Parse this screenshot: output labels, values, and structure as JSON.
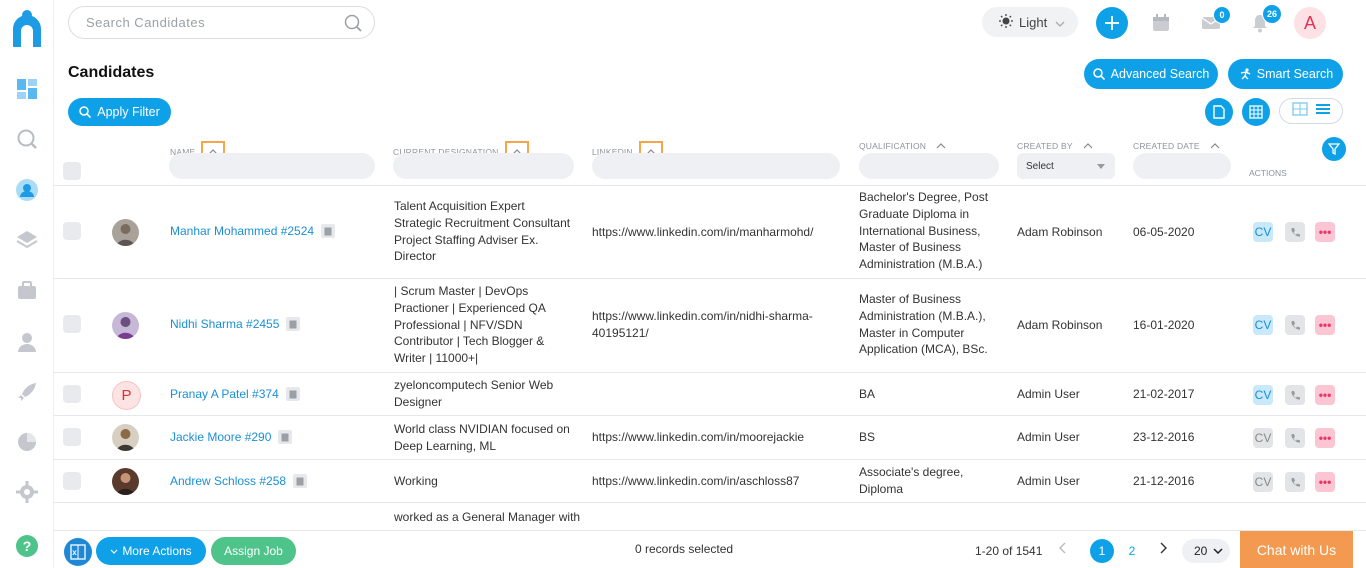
{
  "search": {
    "placeholder": "Search Candidates"
  },
  "theme": {
    "label": "Light"
  },
  "notifications": {
    "mail_count": "0",
    "bell_count": "26"
  },
  "user": {
    "initial": "A"
  },
  "page": {
    "title": "Candidates",
    "advanced_search": "Advanced Search",
    "smart_search": "Smart Search",
    "apply_filter": "Apply Filter"
  },
  "columns": {
    "name": "NAME",
    "designation": "CURRENT DESIGNATION",
    "linkedin": "LINKEDIN",
    "qualification": "QUALIFICATION",
    "created_by": "CREATED BY",
    "created_date": "CREATED DATE",
    "actions": "ACTIONS",
    "created_by_select": "Select"
  },
  "rows": [
    {
      "name": "Manhar Mohammed #2524",
      "designation": [
        "Talent Acquisition Expert",
        "Strategic Recruitment Consultant",
        "Project Staffing Adviser Ex.",
        "Director"
      ],
      "linkedin": [
        "https://www.linkedin.com/in/manharmohd/"
      ],
      "qualification": [
        "Bachelor's Degree, Post",
        "Graduate Diploma in",
        "International Business,",
        "Master of Business",
        "Administration (M.B.A.)"
      ],
      "created_by": "Adam Robinson",
      "created_date": "06-05-2020",
      "cv": "CV"
    },
    {
      "name": "Nidhi Sharma #2455",
      "designation": [
        "| Scrum Master | DevOps",
        "Practioner | Experienced QA",
        "Professional | NFV/SDN",
        "Contributor | Tech Blogger &",
        "Writer | 11000+|"
      ],
      "linkedin": [
        "https://www.linkedin.com/in/nidhi-sharma-",
        "40195121/"
      ],
      "qualification": [
        "Master of Business",
        "Administration (M.B.A.),",
        "Master in Computer",
        "Application (MCA), BSc."
      ],
      "created_by": "Adam Robinson",
      "created_date": "16-01-2020",
      "cv": "CV"
    },
    {
      "name": "Pranay A Patel #374",
      "avatar_letter": "P",
      "designation": [
        "zyeloncomputech Senior Web",
        "Designer"
      ],
      "linkedin": [],
      "qualification": [
        "BA"
      ],
      "created_by": "Admin User",
      "created_date": "21-02-2017",
      "cv": "CV"
    },
    {
      "name": "Jackie Moore #290",
      "designation": [
        "World class NVIDIAN focused on",
        "Deep Learning, ML"
      ],
      "linkedin": [
        "https://www.linkedin.com/in/moorejackie"
      ],
      "qualification": [
        "BS"
      ],
      "created_by": "Admin User",
      "created_date": "23-12-2016",
      "cv": "CV"
    },
    {
      "name": "Andrew Schloss #258",
      "designation": [
        "Working"
      ],
      "linkedin": [
        "https://www.linkedin.com/in/aschloss87"
      ],
      "qualification": [
        "Associate's degree,",
        "Diploma"
      ],
      "created_by": "Admin User",
      "created_date": "21-12-2016",
      "cv": "CV"
    },
    {
      "name": "",
      "designation": [
        "worked as a General Manager with"
      ],
      "linkedin": [],
      "qualification": [],
      "created_by": "",
      "created_date": "",
      "cv": ""
    }
  ],
  "footer": {
    "more_actions": "More Actions",
    "assign_job": "Assign Job",
    "records_selected": "0 records selected",
    "range": "1-20 of 1541",
    "page_1": "1",
    "page_2": "2",
    "per_page": "20",
    "chat": "Chat with Us"
  },
  "colors": {
    "accent": "#0ea1e8",
    "sort_highlight": "#f5a54a",
    "chat": "#f49a50",
    "assign": "#4fc48a"
  }
}
